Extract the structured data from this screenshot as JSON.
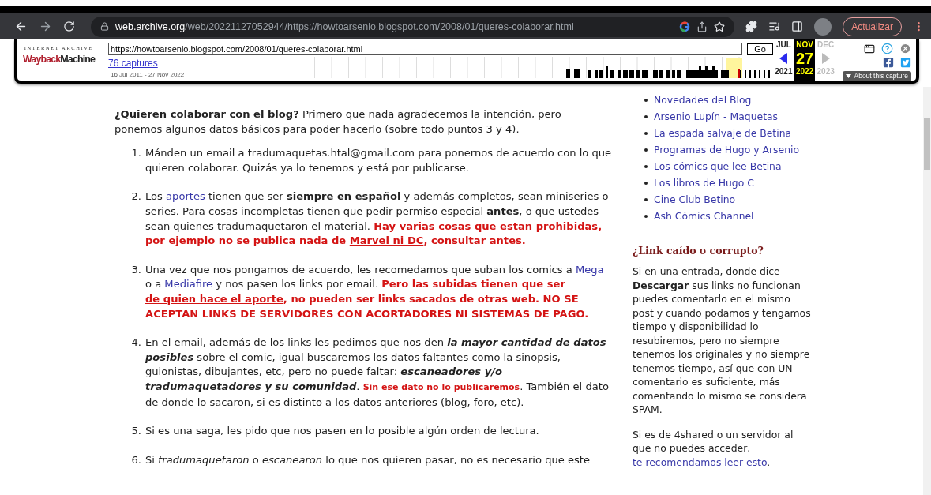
{
  "browser": {
    "url_host": "web.archive.org",
    "url_path": "/web/20221127052944/https://howtoarsenio.blogspot.com/2008/01/queres-colaborar.html",
    "update_button": "Actualizar"
  },
  "wayback": {
    "brand_top": "INTERNET ARCHIVE",
    "logo_first": "Wayback",
    "logo_second": "Machine",
    "url": "https://howtoarsenio.blogspot.com/2008/01/queres-colaborar.html",
    "go": "Go",
    "captures": "76 captures",
    "range": "16 Jul 2011 - 27 Nov 2022",
    "columns": [
      {
        "kind": "prev",
        "month": "JUL",
        "year": "2021",
        "selected": false,
        "disabled": false
      },
      {
        "kind": "current",
        "month": "NOV",
        "day": "27",
        "year": "2022",
        "selected": true,
        "disabled": false
      },
      {
        "kind": "next",
        "month": "DEC",
        "year": "2023",
        "selected": false,
        "disabled": true
      }
    ],
    "about": "About this capture"
  },
  "post": {
    "intro": [
      {
        "kind": "bold",
        "text": "¿Quieren colaborar con el blog?"
      },
      {
        "kind": "text",
        "text": " Primero que nada agradecemos la intención, pero ponemos algunos datos básicos para poder hacerlo (sobre todo puntos 3 y 4)."
      }
    ],
    "items": [
      {
        "number": "1.",
        "segments": [
          {
            "kind": "text",
            "text": "Mánden un email a tradumaquetas.htal@gmail.com para ponernos de acuerdo con lo que quieren colaborar. Quizás ya lo tenemos y está por publicarse."
          }
        ]
      },
      {
        "number": "2.",
        "segments": [
          {
            "kind": "text",
            "text": "Los "
          },
          {
            "kind": "link",
            "text": "aportes"
          },
          {
            "kind": "text",
            "text": " tienen que ser "
          },
          {
            "kind": "bold",
            "text": "siempre en español"
          },
          {
            "kind": "text",
            "text": " y además completos, sean miniseries o series. Para cosas incompletas tienen que pedir permiso especial "
          },
          {
            "kind": "bold",
            "text": "antes"
          },
          {
            "kind": "text",
            "text": ", o que ustedes sean quienes tradumaquetaron el material. "
          },
          {
            "kind": "alert",
            "text": "Hay varias cosas que estan prohibidas, por ejemplo no se publica nada de "
          },
          {
            "kind": "alert-link",
            "text": "Marvel ni DC"
          },
          {
            "kind": "alert",
            "text": ", consultar antes."
          }
        ]
      },
      {
        "number": "3.",
        "segments": [
          {
            "kind": "text",
            "text": "Una vez que nos pongamos de acuerdo, les recomedamos que suban los comics a "
          },
          {
            "kind": "link",
            "text": "Mega"
          },
          {
            "kind": "text",
            "text": " o a "
          },
          {
            "kind": "link",
            "text": "Mediafire"
          },
          {
            "kind": "text",
            "text": " y nos pasen los links por email. "
          },
          {
            "kind": "alert",
            "text": "Pero las subidas tienen que ser "
          },
          {
            "kind": "alert-link",
            "text": "de quien hace el aporte"
          },
          {
            "kind": "alert",
            "text": ", no pueden ser links sacados de otras web. NO SE ACEPTAN LINKS DE SERVIDORES CON ACORTADORES NI SISTEMAS DE PAGO."
          }
        ]
      },
      {
        "number": "4.",
        "segments": [
          {
            "kind": "text",
            "text": "En el email, además de los links les pedimos que nos den "
          },
          {
            "kind": "bold-italic",
            "text": "la mayor cantidad de datos posibles"
          },
          {
            "kind": "text",
            "text": " sobre el comic, igual buscaremos los datos faltantes como la sinopsis, guionistas, dibujantes, etc, pero no puede faltar: "
          },
          {
            "kind": "bold-italic",
            "text": "escaneadores y/o tradumaquetadores y su comunidad"
          },
          {
            "kind": "text",
            "text": ". "
          },
          {
            "kind": "alert-small",
            "text": "Sin ese dato no lo publicaremos"
          },
          {
            "kind": "text",
            "text": ". También el dato de donde lo sacaron, si es distinto a los datos anteriores (blog, foro, etc)."
          }
        ]
      },
      {
        "number": "5.",
        "segments": [
          {
            "kind": "text",
            "text": "Si es una saga, les pido que nos pasen en lo posible algún orden de lectura."
          }
        ]
      },
      {
        "number": "6.",
        "segments": [
          {
            "kind": "text",
            "text": "Si "
          },
          {
            "kind": "italic",
            "text": "tradumaquetaron"
          },
          {
            "kind": "text",
            "text": " o "
          },
          {
            "kind": "italic",
            "text": "escanearon"
          },
          {
            "kind": "text",
            "text": " lo que nos quieren pasar, no es necesario que este"
          }
        ]
      }
    ]
  },
  "sidebar": {
    "links": [
      "Novedades del Blog",
      "Arsenio Lupín - Maquetas",
      "La espada salvaje de Betina",
      "Programas de Hugo y Arsenio",
      "Los cómics que lee Betina",
      "Los libros de Hugo C",
      "Cine Club Betino",
      "Ash Cómics Channel"
    ],
    "heading": "¿Link caído o corrupto?",
    "paragraphs": [
      [
        {
          "kind": "text",
          "text": "Si en una entrada, donde dice "
        },
        {
          "kind": "bold",
          "text": "Descargar"
        },
        {
          "kind": "text",
          "text": " sus links no funcionan puedes comentarlo en el mismo post y cuando podamos y tengamos tiempo y disponibilidad lo resubiremos, pero no siempre tenemos los originales y no siempre tenemos tiempo, así que con UN comentario es suficiente, más comentando lo mismo se considera SPAM."
        }
      ],
      [
        {
          "kind": "text",
          "text": "Si es de 4shared o un servidor al que no puedes acceder, "
        },
        {
          "kind": "link",
          "text": "te recomendamos leer esto"
        },
        {
          "kind": "text",
          "text": "."
        }
      ]
    ]
  }
}
